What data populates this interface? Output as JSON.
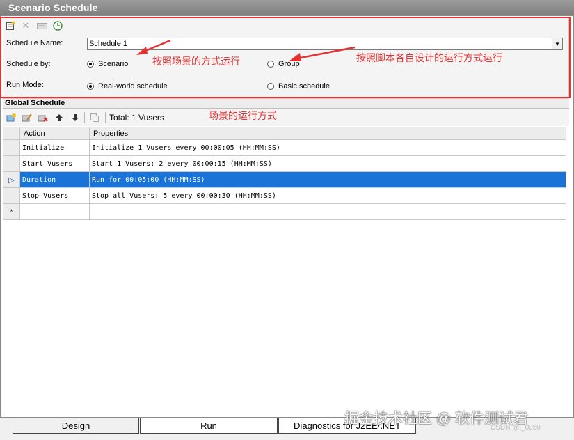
{
  "window": {
    "title": "Scenario Schedule"
  },
  "schedule_form": {
    "name_label": "Schedule Name:",
    "name_value": "Schedule 1",
    "schedule_by_label": "Schedule by:",
    "option_scenario": "Scenario",
    "option_group": "Group",
    "run_mode_label": "Run Mode:",
    "option_real_world": "Real-world schedule",
    "option_basic": "Basic schedule"
  },
  "annotations": {
    "scenario_note": "按照场景的方式运行",
    "group_note": "按照脚本各自设计的运行方式运行",
    "global_note": "场景的运行方式"
  },
  "global_schedule": {
    "title": "Global Schedule",
    "total_text": "Total: 1 Vusers",
    "columns": [
      "Action",
      "Properties"
    ],
    "rows": [
      {
        "action": "Initialize",
        "properties": "Initialize 1 Vusers every 00:00:05 (HH:MM:SS)"
      },
      {
        "action": "Start  Vusers",
        "properties": "Start 1 Vusers: 2 every 00:00:15 (HH:MM:SS)"
      },
      {
        "action": "Duration",
        "properties": "Run for 00:05:00 (HH:MM:SS)"
      },
      {
        "action": "Stop Vusers",
        "properties": "Stop all Vusers: 5 every 00:00:30 (HH:MM:SS)"
      }
    ],
    "new_row_marker": "*",
    "selected_marker": "▷"
  },
  "tabs": [
    "Design",
    "Run",
    "Diagnostics for J2EE/.NET"
  ],
  "watermark": {
    "main": "掘金技术社区 @ 软件测试君",
    "csdn": "CSDN @I_0050"
  },
  "colors": {
    "accent_red": "#e63232",
    "selection_blue": "#1a73d6"
  }
}
